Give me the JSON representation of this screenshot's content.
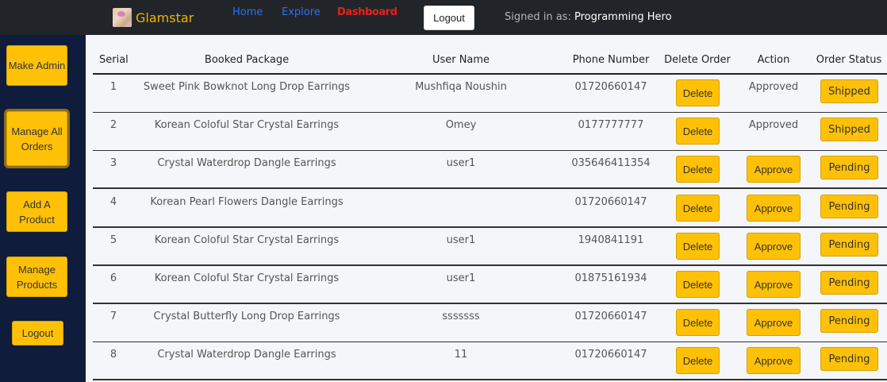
{
  "navbar": {
    "brand": "Glamstar",
    "links": [
      "Home",
      "Explore",
      "Dashboard"
    ],
    "logout_label": "Logout",
    "signed_in_prefix": "Signed in as:",
    "signed_in_user": "Programming Hero"
  },
  "sidebar": {
    "items": [
      {
        "label": "Make Admin"
      },
      {
        "label": "Manage All Orders",
        "active": true
      },
      {
        "label": "Add A Product"
      },
      {
        "label": "Manage Products"
      },
      {
        "label": "Logout"
      }
    ]
  },
  "table": {
    "headers": [
      "Serial",
      "Booked Package",
      "User Name",
      "Phone Number",
      "Delete Order",
      "Action",
      "Order Status"
    ],
    "rows": [
      {
        "serial": "1",
        "package": "Sweet Pink Bowknot Long Drop Earrings",
        "user": "Mushfiqa Noushin",
        "phone": "01720660147",
        "delete": "Delete",
        "action": "Approved",
        "status": "Shipped"
      },
      {
        "serial": "2",
        "package": "Korean Coloful Star Crystal Earrings",
        "user": "Omey",
        "phone": "0177777777",
        "delete": "Delete",
        "action": "Approved",
        "status": "Shipped"
      },
      {
        "serial": "3",
        "package": "Crystal Waterdrop Dangle Earrings",
        "user": "user1",
        "phone": "035646411354",
        "delete": "Delete",
        "action": "Approve",
        "status": "Pending"
      },
      {
        "serial": "4",
        "package": "Korean Pearl Flowers Dangle Earrings",
        "user": "",
        "phone": "01720660147",
        "delete": "Delete",
        "action": "Approve",
        "status": "Pending"
      },
      {
        "serial": "5",
        "package": "Korean Coloful Star Crystal Earrings",
        "user": "user1",
        "phone": "1940841191",
        "delete": "Delete",
        "action": "Approve",
        "status": "Pending"
      },
      {
        "serial": "6",
        "package": "Korean Coloful Star Crystal Earrings",
        "user": "user1",
        "phone": "01875161934",
        "delete": "Delete",
        "action": "Approve",
        "status": "Pending"
      },
      {
        "serial": "7",
        "package": "Crystal Butterfly Long Drop Earrings",
        "user": "sssssss",
        "phone": "01720660147",
        "delete": "Delete",
        "action": "Approve",
        "status": "Pending"
      },
      {
        "serial": "8",
        "package": "Crystal Waterdrop Dangle Earrings",
        "user": "11",
        "phone": "01720660147",
        "delete": "Delete",
        "action": "Approve",
        "status": "Pending"
      }
    ]
  },
  "colors": {
    "navbar_bg": "#212529",
    "sidebar_bg": "#0f1c3b",
    "accent": "#ffc107",
    "brand": "#f0b400",
    "link": "#2f6df6",
    "dashboard_link": "#e8201c"
  }
}
